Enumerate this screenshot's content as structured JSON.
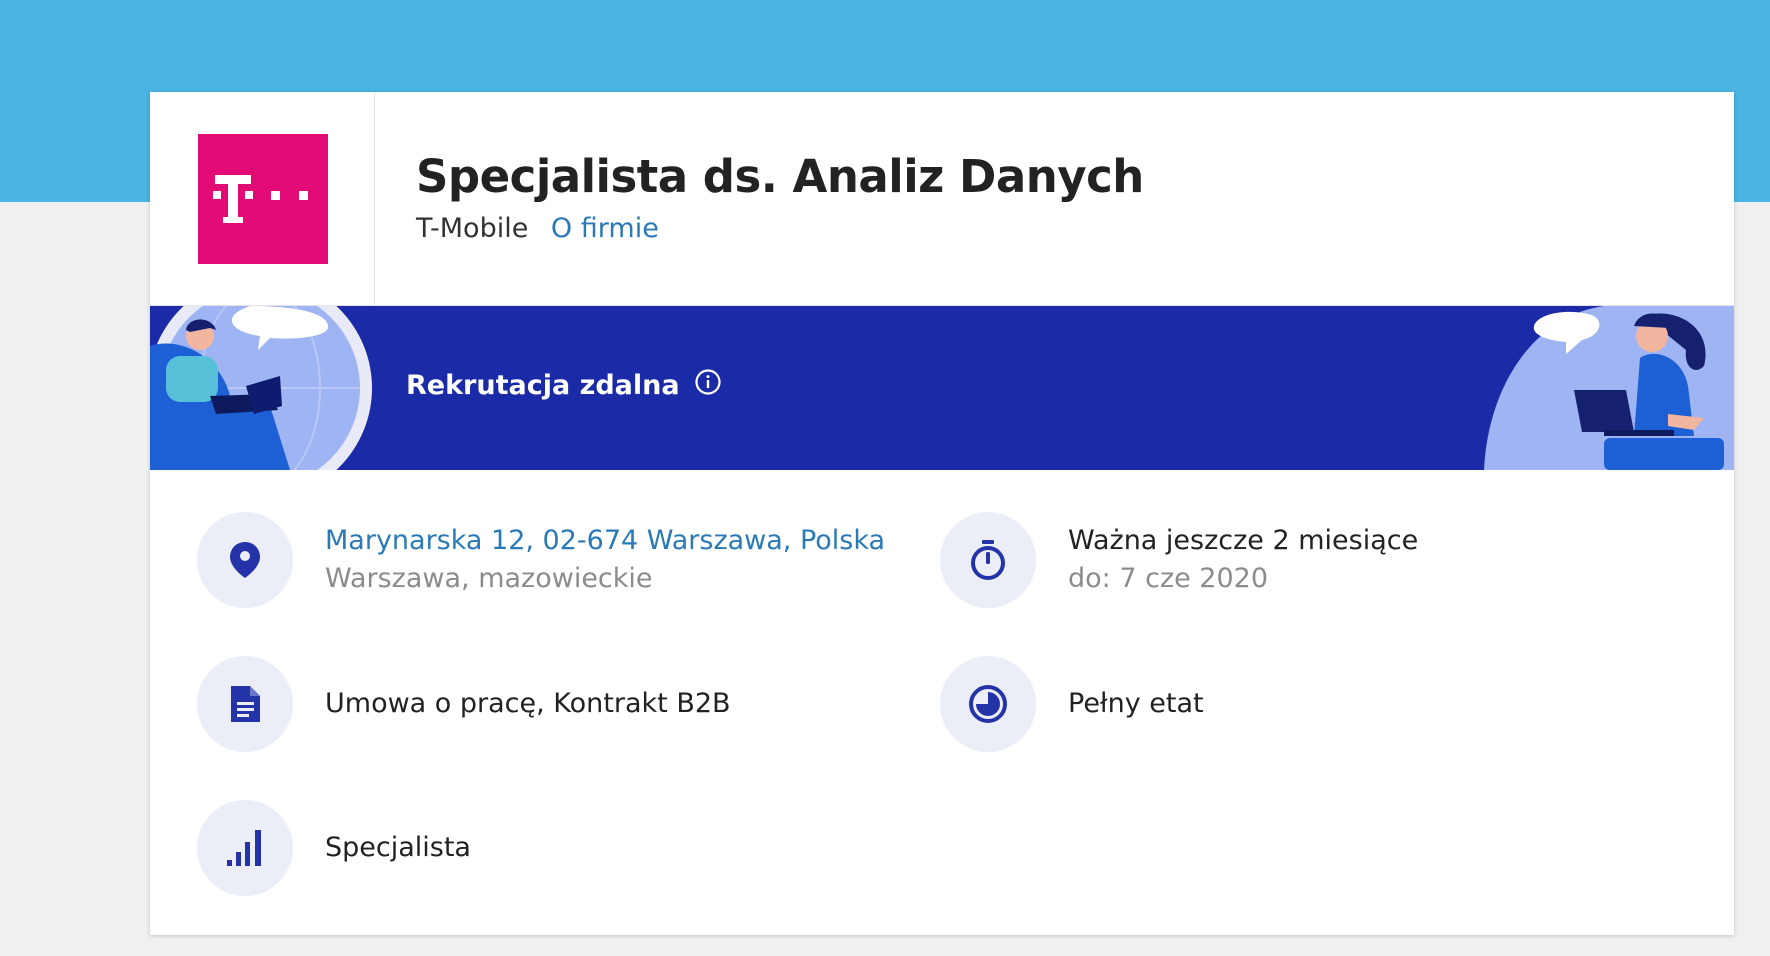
{
  "header": {
    "job_title": "Specjalista ds. Analiz Danych",
    "company_name": "T-Mobile",
    "company_link": "O firmie",
    "logo_text": "T · ·"
  },
  "banner": {
    "label": "Rekrutacja zdalna"
  },
  "details": {
    "location": {
      "address": "Marynarska 12, 02-674 Warszawa, Polska",
      "region": "Warszawa, mazowieckie",
      "icon": "location-pin-icon"
    },
    "validity": {
      "status": "Ważna jeszcze 2 miesiące",
      "until": "do: 7 cze 2020",
      "icon": "stopwatch-icon"
    },
    "contract": {
      "value": "Umowa o pracę, Kontrakt B2B",
      "icon": "document-icon"
    },
    "worktime": {
      "value": "Pełny etat",
      "icon": "clock-pie-icon"
    },
    "level": {
      "value": "Specjalista",
      "icon": "signal-bars-icon"
    }
  },
  "colors": {
    "top_band": "#4ab4e2",
    "brand_magenta": "#e20a74",
    "banner_blue": "#1b2ba8",
    "link_blue": "#2a7ab8",
    "icon_blue": "#2433a8"
  }
}
